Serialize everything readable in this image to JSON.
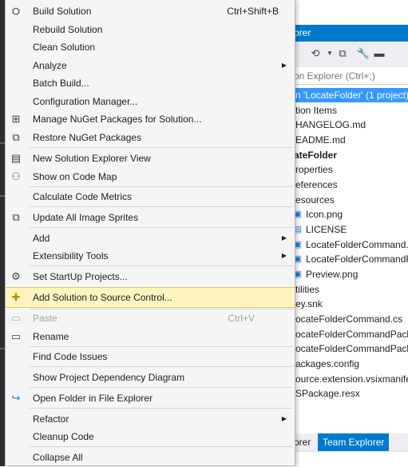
{
  "menu": {
    "items": [
      {
        "label": "Build Solution",
        "shortcut": "Ctrl+Shift+B",
        "icon": "build-icon"
      },
      {
        "label": "Rebuild Solution"
      },
      {
        "label": "Clean Solution"
      },
      {
        "label": "Analyze"
      },
      {
        "label": "Batch Build..."
      },
      {
        "label": "Configuration Manager..."
      },
      {
        "label": "Manage NuGet Packages for Solution...",
        "icon": "nuget-icon"
      },
      {
        "label": "Restore NuGet Packages",
        "icon": "restore-packages-icon"
      },
      {
        "label": "New Solution Explorer View",
        "icon": "new-view-icon"
      },
      {
        "label": "Show on Code Map",
        "icon": "code-map-icon"
      },
      {
        "label": "Calculate Code Metrics"
      },
      {
        "label": "Update All Image Sprites",
        "icon": "sprites-icon"
      },
      {
        "label": "Add"
      },
      {
        "label": "Extensibility Tools"
      },
      {
        "label": "Set StartUp Projects...",
        "icon": "gear-icon"
      },
      {
        "label": "Add Solution to Source Control...",
        "icon": "source-control-icon"
      },
      {
        "label": "Paste",
        "shortcut": "Ctrl+V",
        "icon": "paste-icon"
      },
      {
        "label": "Rename",
        "icon": "rename-icon"
      },
      {
        "label": "Find Code Issues"
      },
      {
        "label": "Show Project Dependency Diagram"
      },
      {
        "label": "Open Folder in File Explorer",
        "icon": "open-folder-icon"
      },
      {
        "label": "Refactor"
      },
      {
        "label": "Cleanup Code"
      },
      {
        "label": "Collapse All"
      }
    ],
    "submenu_arrow": "▶"
  },
  "solution_explorer": {
    "title": "orer",
    "search_placeholder": "on Explorer (Ctrl+;)",
    "tree": [
      "n 'LocateFolder' (1 project)",
      "tion Items",
      "HANGELOG.md",
      "EADME.md",
      "ateFolder",
      "roperties",
      "eferences",
      "esources",
      "Icon.png",
      "LICENSE",
      "LocateFolderCommand.p",
      "LocateFolderCommandP",
      "Preview.png",
      "tilities",
      "ey.snk",
      "ocateFolderCommand.cs",
      "ocateFolderCommandPack",
      "ocateFolderCommandPack",
      "ackages.config",
      "ource.extension.vsixmanife",
      "SPackage.resx"
    ],
    "tabs": [
      "orer",
      "Team Explorer"
    ]
  },
  "colors": {
    "accent": "#007acc",
    "selection": "#3399ff",
    "menu_highlight": "#fdf4bf",
    "menu_background": "#f5f5f5"
  }
}
